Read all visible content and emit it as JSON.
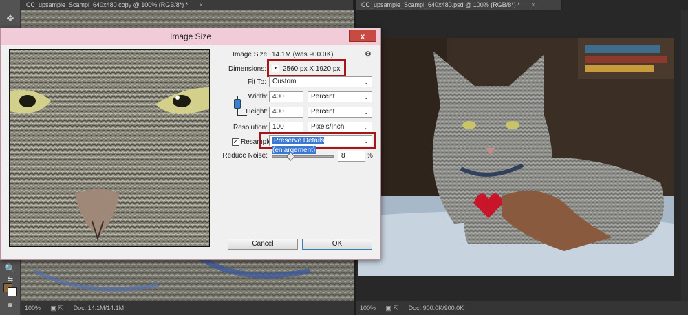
{
  "app": {
    "left_tab_title": "CC_upsample_Scampi_640x480 copy @ 100% (RGB/8*) *",
    "right_tab_title": "CC_upsample_Scampi_640x480.psd @ 100% (RGB/8*) *",
    "tab_close": "×"
  },
  "left_status": {
    "zoom": "100%",
    "doc": "Doc: 14.1M/14.1M"
  },
  "right_status": {
    "zoom": "100%",
    "doc": "Doc: 900.0K/900.0K"
  },
  "dialog": {
    "title": "Image Size",
    "close": "x",
    "image_size_label": "Image Size:",
    "image_size_value": "14.1M (was 900.0K)",
    "gear": "⚙",
    "dimensions_label": "Dimensions:",
    "dimensions_value": "2560 px  X  1920 px",
    "fit_to_label": "Fit To:",
    "fit_to_value": "Custom",
    "width_label": "Width:",
    "width_value": "400",
    "width_unit": "Percent",
    "height_label": "Height:",
    "height_value": "400",
    "height_unit": "Percent",
    "resolution_label": "Resolution:",
    "resolution_value": "100",
    "resolution_unit": "Pixels/Inch",
    "resample_label": "Resample:",
    "resample_value": "Preserve Details (enlargement)",
    "resample_checked": "✓",
    "noise_label": "Reduce Noise:",
    "noise_value": "8",
    "noise_unit": "%",
    "noise_level": 0.3,
    "cancel_label": "Cancel",
    "ok_label": "OK"
  },
  "colors": {
    "highlight": "#a4161a",
    "title_bar": "#f2cbd8",
    "foreground_swatch": "#8b6a3a",
    "background_swatch": "#ffffff"
  }
}
